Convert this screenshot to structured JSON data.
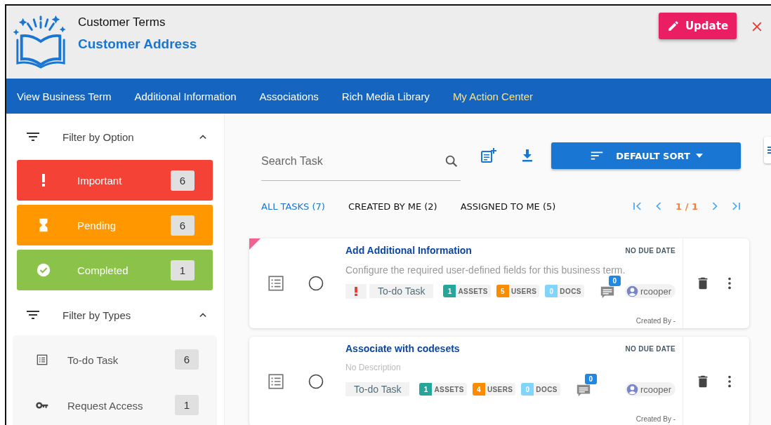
{
  "header": {
    "subtitle": "Customer Terms",
    "title": "Customer Address",
    "update_button": "Update"
  },
  "nav": [
    {
      "label": "View Business Term",
      "selected": false
    },
    {
      "label": "Additional Information",
      "selected": false
    },
    {
      "label": "Associations",
      "selected": false
    },
    {
      "label": "Rich Media Library",
      "selected": false
    },
    {
      "label": "My Action Center",
      "selected": true
    }
  ],
  "option_filter": {
    "title": "Filter by Option",
    "expanded": true,
    "items": [
      {
        "kind": "important",
        "label": "Important",
        "count": "6",
        "color": "#f44336"
      },
      {
        "kind": "pending",
        "label": "Pending",
        "count": "6",
        "color": "#ff9800"
      },
      {
        "kind": "completed",
        "label": "Completed",
        "count": "1",
        "color": "#8bc34a"
      }
    ]
  },
  "type_filter": {
    "title": "Filter by Types",
    "expanded": true,
    "items": [
      {
        "kind": "todo",
        "label": "To-do Task",
        "count": "6"
      },
      {
        "kind": "access",
        "label": "Request Access",
        "count": "1"
      }
    ]
  },
  "search": {
    "placeholder": "Search Task"
  },
  "sort_button": "DEFAULT SORT",
  "task_tabs": [
    {
      "label": "ALL TASKS (7)",
      "selected": true
    },
    {
      "label": "CREATED BY ME (2)",
      "selected": false
    },
    {
      "label": "ASSIGNED TO ME (5)",
      "selected": false
    }
  ],
  "pager": "1 / 1",
  "tasks": [
    {
      "title": "Add Additional Information",
      "due": "NO DUE DATE",
      "description": "Configure the required user-defined fields for this business term.",
      "has_description": true,
      "done": false,
      "flagged": true,
      "important": true,
      "type": "To-do Task",
      "assets": "1",
      "assets_label": "ASSETS",
      "users": "5",
      "users_label": "USERS",
      "docs": "0",
      "docs_label": "DOCS",
      "comments": "0",
      "user": "rcooper",
      "created_by": "Created By -"
    },
    {
      "title": "Associate with codesets",
      "due": "NO DUE DATE",
      "description": "No Description",
      "has_description": false,
      "done": false,
      "flagged": false,
      "important": false,
      "type": "To-do Task",
      "assets": "1",
      "assets_label": "ASSETS",
      "users": "4",
      "users_label": "USERS",
      "docs": "0",
      "docs_label": "DOCS",
      "comments": "0",
      "user": "rcooper",
      "created_by": "Created By -"
    }
  ]
}
